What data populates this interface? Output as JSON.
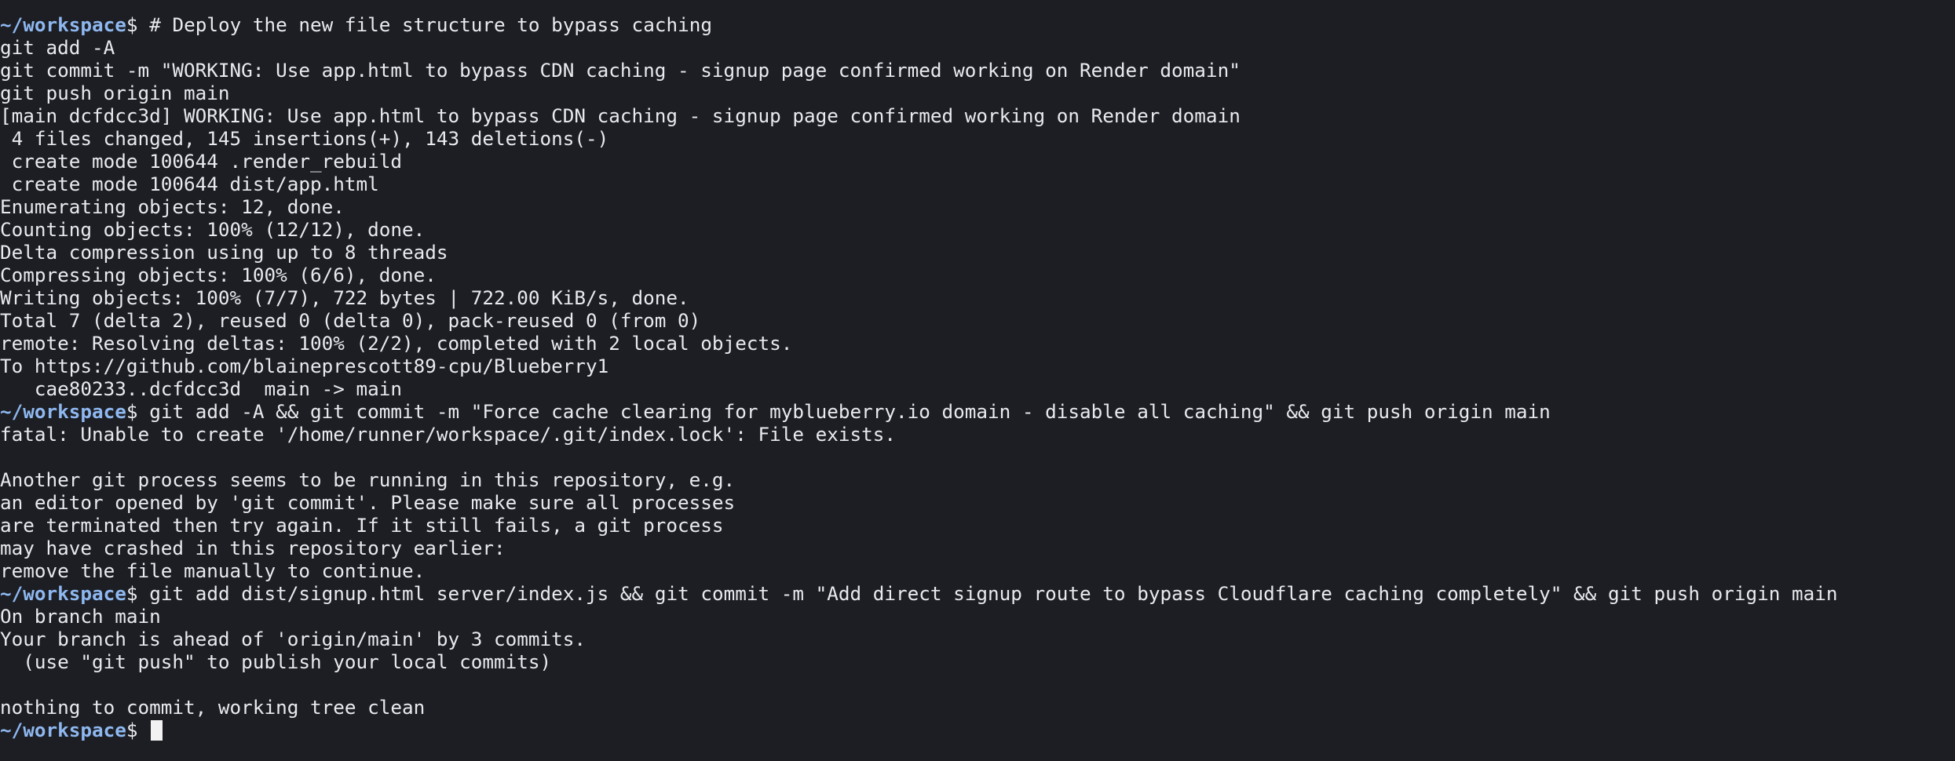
{
  "terminal": {
    "prompt_path": "~/workspace",
    "prompt_sign": "$ ",
    "lines": [
      {
        "type": "prompt",
        "text": "# Deploy the new file structure to bypass caching"
      },
      {
        "type": "output",
        "text": "git add -A"
      },
      {
        "type": "output",
        "text": "git commit -m \"WORKING: Use app.html to bypass CDN caching - signup page confirmed working on Render domain\""
      },
      {
        "type": "output",
        "text": "git push origin main"
      },
      {
        "type": "output",
        "text": "[main dcfdcc3d] WORKING: Use app.html to bypass CDN caching - signup page confirmed working on Render domain"
      },
      {
        "type": "output",
        "text": " 4 files changed, 145 insertions(+), 143 deletions(-)"
      },
      {
        "type": "output",
        "text": " create mode 100644 .render_rebuild"
      },
      {
        "type": "output",
        "text": " create mode 100644 dist/app.html"
      },
      {
        "type": "output",
        "text": "Enumerating objects: 12, done."
      },
      {
        "type": "output",
        "text": "Counting objects: 100% (12/12), done."
      },
      {
        "type": "output",
        "text": "Delta compression using up to 8 threads"
      },
      {
        "type": "output",
        "text": "Compressing objects: 100% (6/6), done."
      },
      {
        "type": "output",
        "text": "Writing objects: 100% (7/7), 722 bytes | 722.00 KiB/s, done."
      },
      {
        "type": "output",
        "text": "Total 7 (delta 2), reused 0 (delta 0), pack-reused 0 (from 0)"
      },
      {
        "type": "output",
        "text": "remote: Resolving deltas: 100% (2/2), completed with 2 local objects."
      },
      {
        "type": "output",
        "text": "To https://github.com/blaineprescott89-cpu/Blueberry1"
      },
      {
        "type": "output",
        "text": "   cae80233..dcfdcc3d  main -> main"
      },
      {
        "type": "prompt",
        "text": "git add -A && git commit -m \"Force cache clearing for myblueberry.io domain - disable all caching\" && git push origin main"
      },
      {
        "type": "output",
        "text": "fatal: Unable to create '/home/runner/workspace/.git/index.lock': File exists."
      },
      {
        "type": "output",
        "text": ""
      },
      {
        "type": "output",
        "text": "Another git process seems to be running in this repository, e.g."
      },
      {
        "type": "output",
        "text": "an editor opened by 'git commit'. Please make sure all processes"
      },
      {
        "type": "output",
        "text": "are terminated then try again. If it still fails, a git process"
      },
      {
        "type": "output",
        "text": "may have crashed in this repository earlier:"
      },
      {
        "type": "output",
        "text": "remove the file manually to continue."
      },
      {
        "type": "prompt",
        "text": "git add dist/signup.html server/index.js && git commit -m \"Add direct signup route to bypass Cloudflare caching completely\" && git push origin main"
      },
      {
        "type": "output",
        "text": "On branch main"
      },
      {
        "type": "output",
        "text": "Your branch is ahead of 'origin/main' by 3 commits."
      },
      {
        "type": "output",
        "text": "  (use \"git push\" to publish your local commits)"
      },
      {
        "type": "output",
        "text": ""
      },
      {
        "type": "output",
        "text": "nothing to commit, working tree clean"
      },
      {
        "type": "cursor",
        "text": ""
      }
    ]
  },
  "colors": {
    "background": "#1c1e24",
    "foreground": "#e8eaee",
    "prompt_path": "#8fb8f0",
    "cursor": "#f2f2f2"
  }
}
